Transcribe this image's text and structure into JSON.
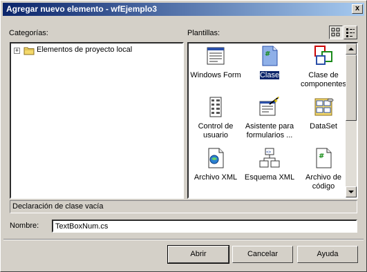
{
  "window": {
    "title": "Agregar nuevo elemento - wfEjemplo3",
    "close_glyph": "x"
  },
  "categories": {
    "label": "Categorías:",
    "items": [
      {
        "label": "Elementos de proyecto local",
        "expander": "+",
        "icon": "folder-icon"
      }
    ]
  },
  "templates": {
    "label": "Plantillas:",
    "view_buttons": [
      "large-icons-view-icon",
      "small-icons-view-icon"
    ],
    "selected": "Clase",
    "items": [
      {
        "label_lines": [
          "Windows Form"
        ],
        "icon": "windows-form-icon"
      },
      {
        "label_lines": [
          "Clase"
        ],
        "icon": "csharp-class-file-icon",
        "selected": true
      },
      {
        "label_lines": [
          "Clase de",
          "componentes"
        ],
        "icon": "component-class-icon"
      },
      {
        "label_lines": [
          "Control de",
          "usuario"
        ],
        "icon": "user-control-icon"
      },
      {
        "label_lines": [
          "Asistente para",
          "formularios ..."
        ],
        "icon": "form-wizard-icon"
      },
      {
        "label_lines": [
          "DataSet"
        ],
        "icon": "dataset-icon"
      },
      {
        "label_lines": [
          "Archivo XML"
        ],
        "icon": "xml-file-icon"
      },
      {
        "label_lines": [
          "Esquema XML"
        ],
        "icon": "xml-schema-icon"
      },
      {
        "label_lines": [
          "Archivo de",
          "código"
        ],
        "icon": "code-file-icon"
      }
    ]
  },
  "description": "Declaración de clase vacía",
  "name_field": {
    "label": "Nombre:",
    "value": "TextBoxNum.cs"
  },
  "buttons": {
    "open": "Abrir",
    "cancel": "Cancelar",
    "help": "Ayuda"
  },
  "colors": {
    "title_start": "#0a246a",
    "title_end": "#a6caf0",
    "dialog_face": "#d4d0c8",
    "selection": "#0a246a"
  }
}
